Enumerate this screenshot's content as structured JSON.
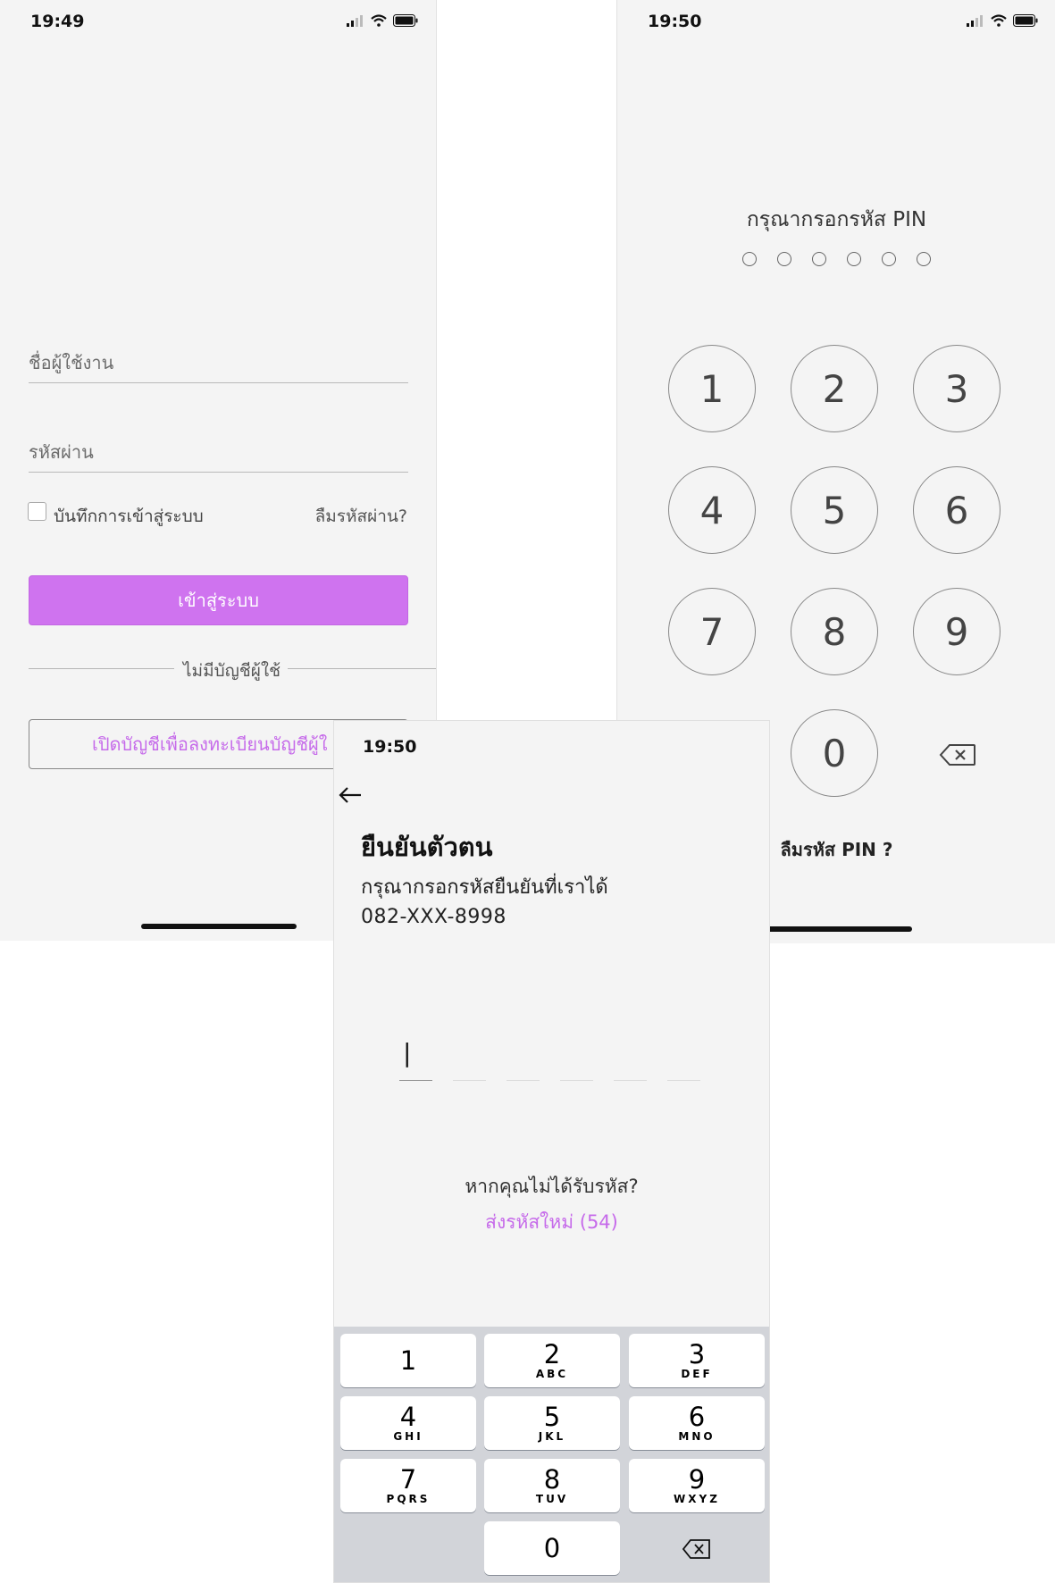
{
  "login": {
    "status_time": "19:49",
    "username_placeholder": "ชื่อผู้ใช้งาน",
    "password_placeholder": "รหัสผ่าน",
    "remember_label": "บันทึกการเข้าสู่ระบบ",
    "forgot_password": "ลืมรหัสผ่าน?",
    "login_button": "เข้าสู่ระบบ",
    "no_account": "ไม่มีบัญชีผู้ใช้",
    "open_account_button": "เปิดบัญชีเพื่อลงทะเบียนบัญชีผู้ใ"
  },
  "pin": {
    "status_time": "19:50",
    "title": "กรุณากรอกรหัส PIN",
    "keys": [
      "1",
      "2",
      "3",
      "4",
      "5",
      "6",
      "7",
      "8",
      "9",
      "0"
    ],
    "forgot_pin": "ลืมรหัส PIN ?"
  },
  "otp": {
    "status_time": "19:50",
    "title": "ยืนยันตัวตน",
    "subtitle": "กรุณากรอกรหัสยืนยันที่เราได้",
    "phone": "082-XXX-8998",
    "cursor": "|",
    "not_received": "หากคุณไม่ได้รับรหัส?",
    "resend": "ส่งรหัสใหม่ (54)",
    "keyboard": [
      {
        "num": "1",
        "letters": ""
      },
      {
        "num": "2",
        "letters": "ABC"
      },
      {
        "num": "3",
        "letters": "DEF"
      },
      {
        "num": "4",
        "letters": "GHI"
      },
      {
        "num": "5",
        "letters": "JKL"
      },
      {
        "num": "6",
        "letters": "MNO"
      },
      {
        "num": "7",
        "letters": "PQRS"
      },
      {
        "num": "8",
        "letters": "TUV"
      },
      {
        "num": "9",
        "letters": "WXYZ"
      },
      {
        "num": "0",
        "letters": ""
      }
    ]
  },
  "colors": {
    "accent": "#cf73ef",
    "background": "#f4f4f4"
  }
}
